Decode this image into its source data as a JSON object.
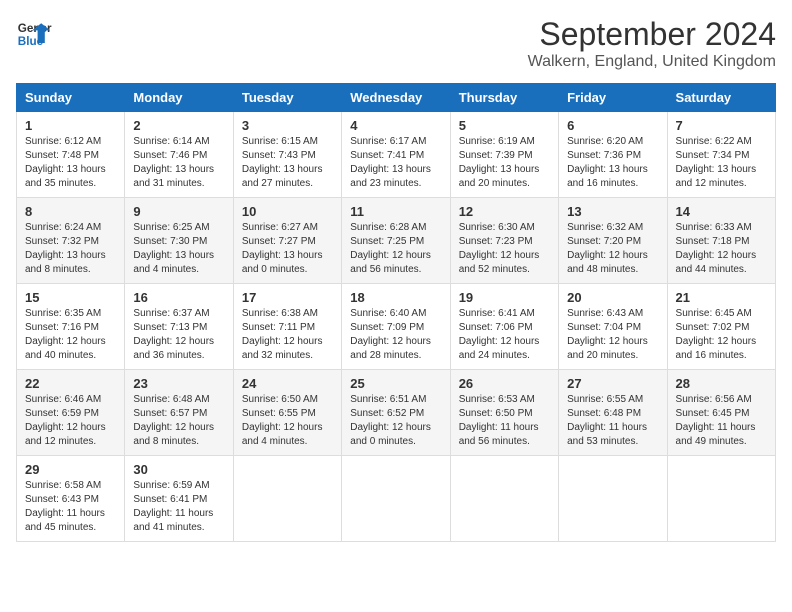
{
  "header": {
    "logo_line1": "General",
    "logo_line2": "Blue",
    "title": "September 2024",
    "subtitle": "Walkern, England, United Kingdom"
  },
  "calendar": {
    "headers": [
      "Sunday",
      "Monday",
      "Tuesday",
      "Wednesday",
      "Thursday",
      "Friday",
      "Saturday"
    ],
    "weeks": [
      [
        {
          "day": "",
          "info": ""
        },
        {
          "day": "2",
          "info": "Sunrise: 6:14 AM\nSunset: 7:46 PM\nDaylight: 13 hours\nand 31 minutes."
        },
        {
          "day": "3",
          "info": "Sunrise: 6:15 AM\nSunset: 7:43 PM\nDaylight: 13 hours\nand 27 minutes."
        },
        {
          "day": "4",
          "info": "Sunrise: 6:17 AM\nSunset: 7:41 PM\nDaylight: 13 hours\nand 23 minutes."
        },
        {
          "day": "5",
          "info": "Sunrise: 6:19 AM\nSunset: 7:39 PM\nDaylight: 13 hours\nand 20 minutes."
        },
        {
          "day": "6",
          "info": "Sunrise: 6:20 AM\nSunset: 7:36 PM\nDaylight: 13 hours\nand 16 minutes."
        },
        {
          "day": "7",
          "info": "Sunrise: 6:22 AM\nSunset: 7:34 PM\nDaylight: 13 hours\nand 12 minutes."
        }
      ],
      [
        {
          "day": "1",
          "info": "Sunrise: 6:12 AM\nSunset: 7:48 PM\nDaylight: 13 hours\nand 35 minutes."
        },
        {
          "day": "",
          "info": ""
        },
        {
          "day": "",
          "info": ""
        },
        {
          "day": "",
          "info": ""
        },
        {
          "day": "",
          "info": ""
        },
        {
          "day": "",
          "info": ""
        },
        {
          "day": "",
          "info": ""
        }
      ],
      [
        {
          "day": "8",
          "info": "Sunrise: 6:24 AM\nSunset: 7:32 PM\nDaylight: 13 hours\nand 8 minutes."
        },
        {
          "day": "9",
          "info": "Sunrise: 6:25 AM\nSunset: 7:30 PM\nDaylight: 13 hours\nand 4 minutes."
        },
        {
          "day": "10",
          "info": "Sunrise: 6:27 AM\nSunset: 7:27 PM\nDaylight: 13 hours\nand 0 minutes."
        },
        {
          "day": "11",
          "info": "Sunrise: 6:28 AM\nSunset: 7:25 PM\nDaylight: 12 hours\nand 56 minutes."
        },
        {
          "day": "12",
          "info": "Sunrise: 6:30 AM\nSunset: 7:23 PM\nDaylight: 12 hours\nand 52 minutes."
        },
        {
          "day": "13",
          "info": "Sunrise: 6:32 AM\nSunset: 7:20 PM\nDaylight: 12 hours\nand 48 minutes."
        },
        {
          "day": "14",
          "info": "Sunrise: 6:33 AM\nSunset: 7:18 PM\nDaylight: 12 hours\nand 44 minutes."
        }
      ],
      [
        {
          "day": "15",
          "info": "Sunrise: 6:35 AM\nSunset: 7:16 PM\nDaylight: 12 hours\nand 40 minutes."
        },
        {
          "day": "16",
          "info": "Sunrise: 6:37 AM\nSunset: 7:13 PM\nDaylight: 12 hours\nand 36 minutes."
        },
        {
          "day": "17",
          "info": "Sunrise: 6:38 AM\nSunset: 7:11 PM\nDaylight: 12 hours\nand 32 minutes."
        },
        {
          "day": "18",
          "info": "Sunrise: 6:40 AM\nSunset: 7:09 PM\nDaylight: 12 hours\nand 28 minutes."
        },
        {
          "day": "19",
          "info": "Sunrise: 6:41 AM\nSunset: 7:06 PM\nDaylight: 12 hours\nand 24 minutes."
        },
        {
          "day": "20",
          "info": "Sunrise: 6:43 AM\nSunset: 7:04 PM\nDaylight: 12 hours\nand 20 minutes."
        },
        {
          "day": "21",
          "info": "Sunrise: 6:45 AM\nSunset: 7:02 PM\nDaylight: 12 hours\nand 16 minutes."
        }
      ],
      [
        {
          "day": "22",
          "info": "Sunrise: 6:46 AM\nSunset: 6:59 PM\nDaylight: 12 hours\nand 12 minutes."
        },
        {
          "day": "23",
          "info": "Sunrise: 6:48 AM\nSunset: 6:57 PM\nDaylight: 12 hours\nand 8 minutes."
        },
        {
          "day": "24",
          "info": "Sunrise: 6:50 AM\nSunset: 6:55 PM\nDaylight: 12 hours\nand 4 minutes."
        },
        {
          "day": "25",
          "info": "Sunrise: 6:51 AM\nSunset: 6:52 PM\nDaylight: 12 hours\nand 0 minutes."
        },
        {
          "day": "26",
          "info": "Sunrise: 6:53 AM\nSunset: 6:50 PM\nDaylight: 11 hours\nand 56 minutes."
        },
        {
          "day": "27",
          "info": "Sunrise: 6:55 AM\nSunset: 6:48 PM\nDaylight: 11 hours\nand 53 minutes."
        },
        {
          "day": "28",
          "info": "Sunrise: 6:56 AM\nSunset: 6:45 PM\nDaylight: 11 hours\nand 49 minutes."
        }
      ],
      [
        {
          "day": "29",
          "info": "Sunrise: 6:58 AM\nSunset: 6:43 PM\nDaylight: 11 hours\nand 45 minutes."
        },
        {
          "day": "30",
          "info": "Sunrise: 6:59 AM\nSunset: 6:41 PM\nDaylight: 11 hours\nand 41 minutes."
        },
        {
          "day": "",
          "info": ""
        },
        {
          "day": "",
          "info": ""
        },
        {
          "day": "",
          "info": ""
        },
        {
          "day": "",
          "info": ""
        },
        {
          "day": "",
          "info": ""
        }
      ]
    ]
  }
}
